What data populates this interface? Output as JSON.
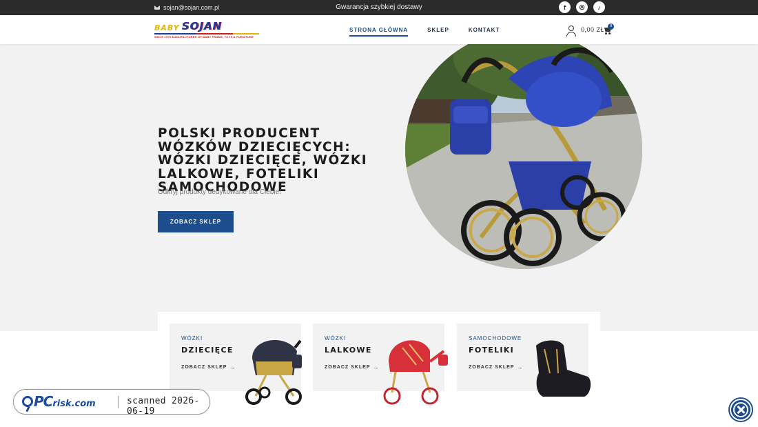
{
  "topbar": {
    "email": "sojan@sojan.com.pl",
    "promo": "Gwarancja szybkiej dostawy",
    "socials": [
      {
        "icon": "facebook-icon",
        "glyph": "f"
      },
      {
        "icon": "instagram-icon",
        "glyph": "◎"
      },
      {
        "icon": "tiktok-icon",
        "glyph": "♪"
      }
    ]
  },
  "header": {
    "logo": {
      "baby": "BABY",
      "sojan": "SOJAN",
      "tagline": "SINCE 1979 MANUFACTURER OF BABY PRAMS, TOYS & FURNITURE"
    },
    "nav": [
      {
        "label": "STRONA GŁÓWNA",
        "active": true
      },
      {
        "label": "SKLEP",
        "active": false
      },
      {
        "label": "KONTAKT",
        "active": false
      }
    ],
    "cart_total": "0,00 ZŁ",
    "cart_count": "0"
  },
  "hero": {
    "title": "POLSKI PRODUCENT WÓZKÓW DZIECIĘCYCH: WÓZKI DZIECIĘCE, WÓZKI LALKOWE, FOTELIKI SAMOCHODOWE",
    "subtitle": "Odkryj produkty dedykowane dla Ciebie!",
    "button": "ZOBACZ SKLEP"
  },
  "categories": [
    {
      "kicker": "WÓZKI",
      "title": "DZIECIĘCE",
      "link": "ZOBACZ SKLEP",
      "arrow": "→"
    },
    {
      "kicker": "WÓZKI",
      "title": "LALKOWE",
      "link": "ZOBACZ SKLEP",
      "arrow": "→"
    },
    {
      "kicker": "SAMOCHODOWE",
      "title": "FOTELIKI",
      "link": "ZOBACZ SKLEP",
      "arrow": "→"
    }
  ],
  "overlay": {
    "pc": "PC",
    "risk": "risk.com",
    "scanned": "scanned 2026-06-19"
  },
  "colors": {
    "accent": "#1d4d8c",
    "topbar": "#2b2b2b",
    "hero_bg": "#f2f2f2"
  }
}
